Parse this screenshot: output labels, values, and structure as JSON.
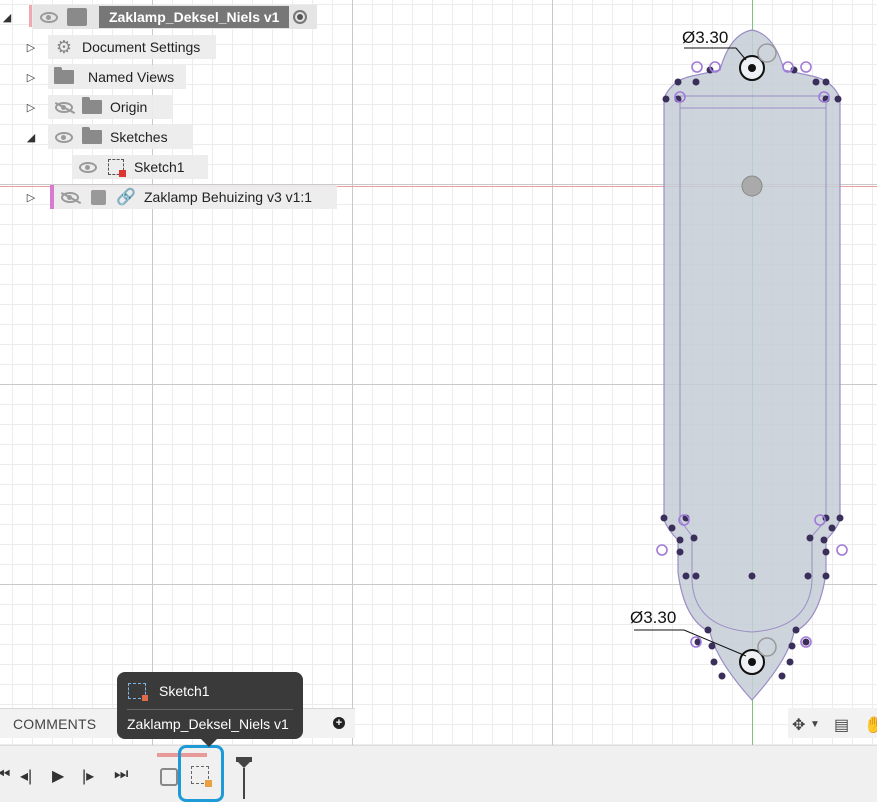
{
  "browser": {
    "root": {
      "label": "Zaklamp_Deksel_Niels v1"
    },
    "items": [
      {
        "label": "Document Settings",
        "icon": "gear-icon"
      },
      {
        "label": "Named Views",
        "icon": "folder-icon"
      },
      {
        "label": "Origin",
        "icon": "folder-icon",
        "visibility": "hidden"
      },
      {
        "label": "Sketches",
        "icon": "folder-icon",
        "visibility": "visible",
        "expanded": true
      },
      {
        "label": "Sketch1",
        "icon": "sketch-icon",
        "visibility": "visible"
      },
      {
        "label": "Zaklamp Behuizing v3 v1:1",
        "icon": "component-icon",
        "visibility": "hidden"
      }
    ]
  },
  "sketch": {
    "dimension_top": "Ø3.30",
    "dimension_bottom": "Ø3.30",
    "colors": {
      "profile_fill": "#c5ccd6",
      "profile_stroke": "#9a8ec6",
      "constraint_point": "#3a2f5a",
      "open_point": "#a07ad8"
    }
  },
  "comments": {
    "label": "COMMENTS",
    "add_icon": "plus-circle-icon"
  },
  "tooltip": {
    "title": "Sketch1",
    "subtitle": "Zaklamp_Deksel_Niels v1"
  },
  "timeline": {
    "controls": [
      "skip-to-start-icon",
      "step-back-icon",
      "play-icon",
      "step-forward-icon",
      "skip-to-end-icon"
    ]
  },
  "nav_tools": [
    "orbit-icon",
    "display-settings-icon",
    "pan-icon"
  ]
}
